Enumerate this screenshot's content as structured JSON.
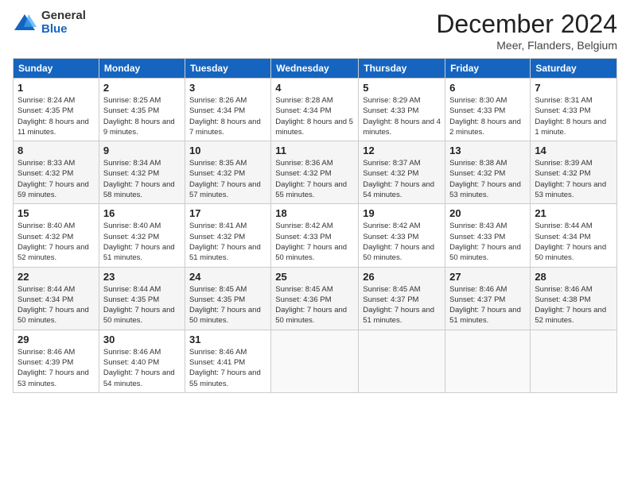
{
  "logo": {
    "general": "General",
    "blue": "Blue"
  },
  "header": {
    "month": "December 2024",
    "location": "Meer, Flanders, Belgium"
  },
  "days_of_week": [
    "Sunday",
    "Monday",
    "Tuesday",
    "Wednesday",
    "Thursday",
    "Friday",
    "Saturday"
  ],
  "weeks": [
    [
      {
        "day": "1",
        "sunrise": "8:24 AM",
        "sunset": "4:35 PM",
        "daylight": "8 hours and 11 minutes."
      },
      {
        "day": "2",
        "sunrise": "8:25 AM",
        "sunset": "4:35 PM",
        "daylight": "8 hours and 9 minutes."
      },
      {
        "day": "3",
        "sunrise": "8:26 AM",
        "sunset": "4:34 PM",
        "daylight": "8 hours and 7 minutes."
      },
      {
        "day": "4",
        "sunrise": "8:28 AM",
        "sunset": "4:34 PM",
        "daylight": "8 hours and 5 minutes."
      },
      {
        "day": "5",
        "sunrise": "8:29 AM",
        "sunset": "4:33 PM",
        "daylight": "8 hours and 4 minutes."
      },
      {
        "day": "6",
        "sunrise": "8:30 AM",
        "sunset": "4:33 PM",
        "daylight": "8 hours and 2 minutes."
      },
      {
        "day": "7",
        "sunrise": "8:31 AM",
        "sunset": "4:33 PM",
        "daylight": "8 hours and 1 minute."
      }
    ],
    [
      {
        "day": "8",
        "sunrise": "8:33 AM",
        "sunset": "4:32 PM",
        "daylight": "7 hours and 59 minutes."
      },
      {
        "day": "9",
        "sunrise": "8:34 AM",
        "sunset": "4:32 PM",
        "daylight": "7 hours and 58 minutes."
      },
      {
        "day": "10",
        "sunrise": "8:35 AM",
        "sunset": "4:32 PM",
        "daylight": "7 hours and 57 minutes."
      },
      {
        "day": "11",
        "sunrise": "8:36 AM",
        "sunset": "4:32 PM",
        "daylight": "7 hours and 55 minutes."
      },
      {
        "day": "12",
        "sunrise": "8:37 AM",
        "sunset": "4:32 PM",
        "daylight": "7 hours and 54 minutes."
      },
      {
        "day": "13",
        "sunrise": "8:38 AM",
        "sunset": "4:32 PM",
        "daylight": "7 hours and 53 minutes."
      },
      {
        "day": "14",
        "sunrise": "8:39 AM",
        "sunset": "4:32 PM",
        "daylight": "7 hours and 53 minutes."
      }
    ],
    [
      {
        "day": "15",
        "sunrise": "8:40 AM",
        "sunset": "4:32 PM",
        "daylight": "7 hours and 52 minutes."
      },
      {
        "day": "16",
        "sunrise": "8:40 AM",
        "sunset": "4:32 PM",
        "daylight": "7 hours and 51 minutes."
      },
      {
        "day": "17",
        "sunrise": "8:41 AM",
        "sunset": "4:32 PM",
        "daylight": "7 hours and 51 minutes."
      },
      {
        "day": "18",
        "sunrise": "8:42 AM",
        "sunset": "4:33 PM",
        "daylight": "7 hours and 50 minutes."
      },
      {
        "day": "19",
        "sunrise": "8:42 AM",
        "sunset": "4:33 PM",
        "daylight": "7 hours and 50 minutes."
      },
      {
        "day": "20",
        "sunrise": "8:43 AM",
        "sunset": "4:33 PM",
        "daylight": "7 hours and 50 minutes."
      },
      {
        "day": "21",
        "sunrise": "8:44 AM",
        "sunset": "4:34 PM",
        "daylight": "7 hours and 50 minutes."
      }
    ],
    [
      {
        "day": "22",
        "sunrise": "8:44 AM",
        "sunset": "4:34 PM",
        "daylight": "7 hours and 50 minutes."
      },
      {
        "day": "23",
        "sunrise": "8:44 AM",
        "sunset": "4:35 PM",
        "daylight": "7 hours and 50 minutes."
      },
      {
        "day": "24",
        "sunrise": "8:45 AM",
        "sunset": "4:35 PM",
        "daylight": "7 hours and 50 minutes."
      },
      {
        "day": "25",
        "sunrise": "8:45 AM",
        "sunset": "4:36 PM",
        "daylight": "7 hours and 50 minutes."
      },
      {
        "day": "26",
        "sunrise": "8:45 AM",
        "sunset": "4:37 PM",
        "daylight": "7 hours and 51 minutes."
      },
      {
        "day": "27",
        "sunrise": "8:46 AM",
        "sunset": "4:37 PM",
        "daylight": "7 hours and 51 minutes."
      },
      {
        "day": "28",
        "sunrise": "8:46 AM",
        "sunset": "4:38 PM",
        "daylight": "7 hours and 52 minutes."
      }
    ],
    [
      {
        "day": "29",
        "sunrise": "8:46 AM",
        "sunset": "4:39 PM",
        "daylight": "7 hours and 53 minutes."
      },
      {
        "day": "30",
        "sunrise": "8:46 AM",
        "sunset": "4:40 PM",
        "daylight": "7 hours and 54 minutes."
      },
      {
        "day": "31",
        "sunrise": "8:46 AM",
        "sunset": "4:41 PM",
        "daylight": "7 hours and 55 minutes."
      },
      null,
      null,
      null,
      null
    ]
  ],
  "labels": {
    "sunrise": "Sunrise: ",
    "sunset": "Sunset: ",
    "daylight": "Daylight: "
  }
}
